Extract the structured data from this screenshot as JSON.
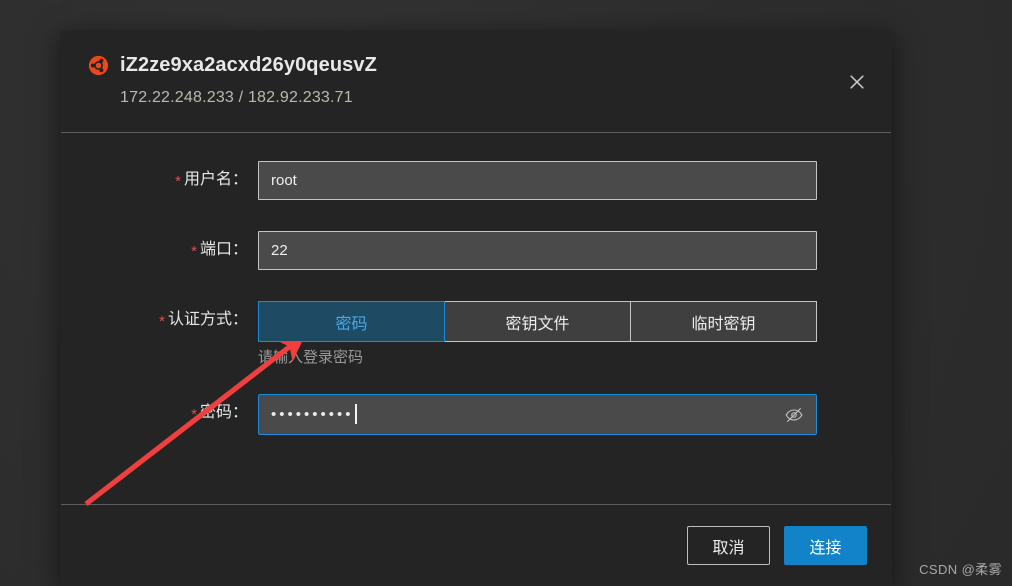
{
  "dialog": {
    "icon": "ubuntu-logo-icon",
    "title": "iZ2ze9xa2acxd26y0qeusvZ",
    "ip_line": "172.22.248.233 / 182.92.233.71",
    "close_icon": "close-icon"
  },
  "form": {
    "username": {
      "required_marker": "*",
      "label": "用户名：",
      "value": "root",
      "placeholder": ""
    },
    "port": {
      "required_marker": "*",
      "label": "端口：",
      "value": "22",
      "placeholder": ""
    },
    "auth_method": {
      "required_marker": "*",
      "label": "认证方式：",
      "options": [
        "密码",
        "密钥文件",
        "临时密钥"
      ],
      "selected": "密码",
      "helper_text": "请输入登录密码"
    },
    "password": {
      "required_marker": "*",
      "label": "密码：",
      "value": "••••••••••",
      "masked_char_count": 10,
      "placeholder": "",
      "toggle_icon": "eye-slash-icon"
    }
  },
  "footer": {
    "cancel_label": "取消",
    "connect_label": "连接"
  },
  "annotation": {
    "type": "arrow",
    "color": "#f03f3f",
    "points_to": "密码"
  },
  "watermark": {
    "text": "CSDN @柔雾"
  },
  "colors": {
    "accent_blue": "#1283c8",
    "focus_blue": "#1a8ada",
    "selected_tab_bg": "#1e4b63",
    "selected_tab_text": "#4aa8e8",
    "required_red": "#d9514c",
    "ubuntu_orange": "#e8491d",
    "modal_bg": "#242424",
    "page_bg": "#2e2e2e",
    "input_bg": "#4a4a4a",
    "input_border": "#c4c4c4"
  }
}
